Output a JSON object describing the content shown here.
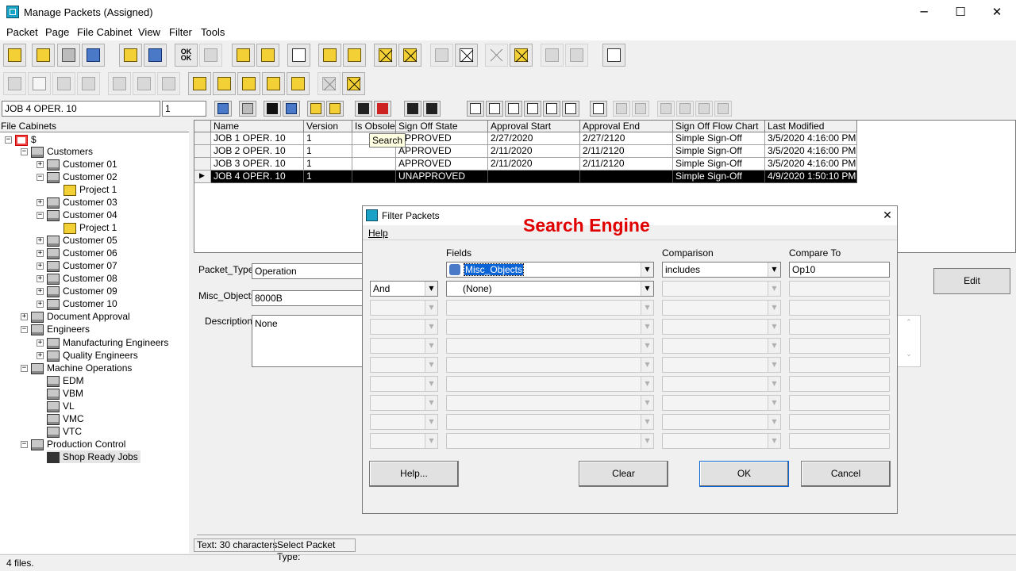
{
  "window": {
    "title": "Manage Packets (Assigned)",
    "minimize": "─",
    "maximize": "☐",
    "close": "✕"
  },
  "menu": [
    "Packet",
    "Page",
    "File Cabinet",
    "View",
    "Filter",
    "Tools"
  ],
  "search": {
    "packet_name": "JOB 4 OPER. 10",
    "page_number": "1"
  },
  "tree": {
    "label": "File Cabinets",
    "root": "$",
    "nodes": [
      "Customers",
      "Customer 01",
      "Customer 02",
      "Project 1",
      "Customer 03",
      "Customer 04",
      "Project 1",
      "Customer 05",
      "Customer 06",
      "Customer 07",
      "Customer 08",
      "Customer 09",
      "Customer 10",
      "Document Approval",
      "Engineers",
      "Manufacturing Engineers",
      "Quality Engineers",
      "Machine Operations",
      "EDM",
      "VBM",
      "VL",
      "VMC",
      "VTC",
      "Production Control",
      "Shop Ready Jobs"
    ]
  },
  "grid": {
    "columns": [
      "Name",
      "Version",
      "Is Obsolete",
      "Sign Off State",
      "Approval Start",
      "Approval End",
      "Sign Off Flow Chart",
      "Last Modified"
    ],
    "rows": [
      [
        "JOB 1 OPER. 10",
        "1",
        "",
        "APPROVED",
        "2/27/2020",
        "2/27/2120",
        "Simple Sign-Off",
        "3/5/2020 4:16:00 PM"
      ],
      [
        "JOB 2 OPER. 10",
        "1",
        "",
        "APPROVED",
        "2/11/2020",
        "2/11/2120",
        "Simple Sign-Off",
        "3/5/2020 4:16:00 PM"
      ],
      [
        "JOB 3 OPER. 10",
        "1",
        "",
        "APPROVED",
        "2/11/2020",
        "2/11/2120",
        "Simple Sign-Off",
        "3/5/2020 4:16:00 PM"
      ],
      [
        "JOB 4 OPER. 10",
        "1",
        "",
        "UNAPPROVED",
        "",
        "",
        "Simple Sign-Off",
        "4/9/2020 1:50:10 PM"
      ]
    ],
    "tooltip": "Search"
  },
  "details": {
    "packet_type_label": "Packet_Type:",
    "packet_type_value": "Operation",
    "misc_objects_label": "Misc_Objects:",
    "misc_objects_value": "8000B",
    "description_label": "Description:",
    "description_value": "None",
    "edit_button": "Edit"
  },
  "status": {
    "text_chars": "Text: 30 characters",
    "select_type": "Select Packet Type:",
    "files": "4 files."
  },
  "dialog": {
    "title": "Filter Packets",
    "menu_help": "Help",
    "headers": {
      "fields": "Fields",
      "comparison": "Comparison",
      "compare_to": "Compare To"
    },
    "row1": {
      "field": "Misc_Objects",
      "comparison": "includes",
      "compare_to": "Op10"
    },
    "row2": {
      "connector": "And",
      "field": "(None)"
    },
    "buttons": {
      "help": "Help...",
      "clear": "Clear",
      "ok": "OK",
      "cancel": "Cancel"
    }
  },
  "annotation": "Search Engine"
}
